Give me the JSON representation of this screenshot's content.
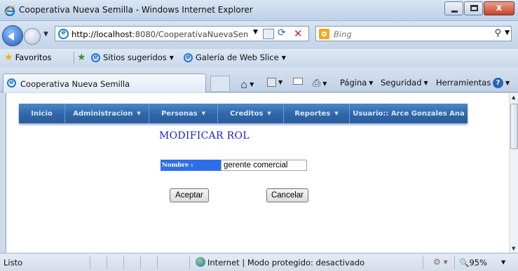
{
  "window": {
    "title": "Cooperativa Nueva Semilla - Windows Internet Explorer",
    "close_glyph": "x"
  },
  "address_bar": {
    "url_host": "http://localhost",
    "url_rest": ":8080/CooperativaNuevaSen",
    "search_placeholder": "Bing"
  },
  "favorites_bar": {
    "favorites_label": "Favoritos",
    "links": [
      "Sitios sugeridos",
      "Galería de Web Slice"
    ]
  },
  "tab": {
    "label": "Cooperativa Nueva Semilla"
  },
  "command_bar": {
    "pagina": "Página",
    "seguridad": "Seguridad",
    "herramientas": "Herramientas",
    "help_glyph": "?"
  },
  "app": {
    "menu": [
      "Inicio",
      "Administracion",
      "Personas",
      "Creditos",
      "Reportes",
      "Usuario:: Arce Gonzales Ana"
    ],
    "heading": "MODIFICAR ROL",
    "nombre_label": "Nombre :",
    "nombre_value": "gerente comercial",
    "accept_label": "Aceptar",
    "cancel_label": "Cancelar"
  },
  "status_bar": {
    "status": "Listo",
    "zone": "Internet | Modo protegido: desactivado",
    "zoom": "95%"
  },
  "colors": {
    "menu_bar": "#2f66aa",
    "heading": "#1f1fd0",
    "label_bg": "#2d6ee8"
  }
}
